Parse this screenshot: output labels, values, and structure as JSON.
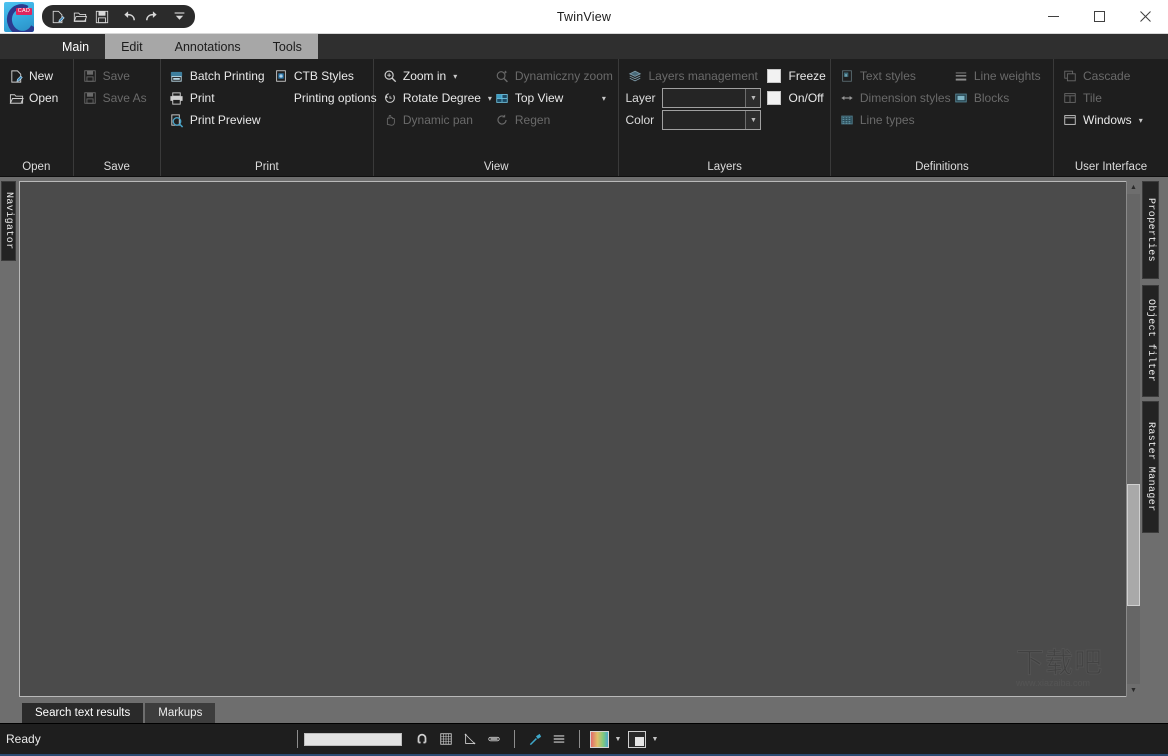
{
  "window": {
    "title": "TwinView",
    "controls": {
      "minimize": "minimize-button",
      "maximize": "maximize-button",
      "close": "close-button"
    }
  },
  "quick_access": {
    "items": [
      {
        "name": "new-document-icon",
        "tooltip": "New"
      },
      {
        "name": "open-folder-icon",
        "tooltip": "Open"
      },
      {
        "name": "save-icon",
        "tooltip": "Save"
      },
      {
        "name": "undo-icon",
        "tooltip": "Undo"
      },
      {
        "name": "redo-icon",
        "tooltip": "Redo"
      },
      {
        "name": "customize-qat-icon",
        "tooltip": "Customize Quick Access Toolbar"
      }
    ]
  },
  "ribbon": {
    "tabs": [
      {
        "label": "Main",
        "active": true
      },
      {
        "label": "Edit",
        "active": false
      },
      {
        "label": "Annotations",
        "active": false
      },
      {
        "label": "Tools",
        "active": false
      }
    ],
    "groups": [
      {
        "title": "Open",
        "items": [
          {
            "label": "New",
            "icon": "new-file-icon",
            "disabled": false
          },
          {
            "label": "Open",
            "icon": "open-folder-icon",
            "disabled": false
          }
        ]
      },
      {
        "title": "Save",
        "items": [
          {
            "label": "Save",
            "icon": "save-icon",
            "disabled": true
          },
          {
            "label": "Save As",
            "icon": "save-as-icon",
            "disabled": true
          }
        ]
      },
      {
        "title": "Print",
        "col1": [
          {
            "label": "Batch Printing",
            "icon": "batch-printing-icon",
            "disabled": false
          },
          {
            "label": "Print",
            "icon": "print-icon",
            "disabled": false
          },
          {
            "label": "Print Preview",
            "icon": "print-preview-icon",
            "disabled": false
          }
        ],
        "col2": [
          {
            "label": "CTB Styles",
            "icon": "ctb-styles-icon",
            "disabled": false
          },
          {
            "label": "Printing options",
            "icon": "",
            "disabled": false
          }
        ]
      },
      {
        "title": "View",
        "col1": [
          {
            "label": "Zoom in",
            "icon": "zoom-in-icon",
            "disabled": false,
            "caret": true
          },
          {
            "label": "Rotate Degree",
            "icon": "rotate-degree-icon",
            "disabled": false,
            "caret": true
          },
          {
            "label": "Dynamic pan",
            "icon": "dynamic-pan-icon",
            "disabled": true,
            "caret": false
          }
        ],
        "col2": [
          {
            "label": "Dynamiczny zoom",
            "icon": "dynamic-zoom-icon",
            "disabled": true,
            "caret": false
          },
          {
            "label": "Top View",
            "icon": "top-view-icon",
            "disabled": false,
            "caret": true
          },
          {
            "label": "Regen",
            "icon": "regen-icon",
            "disabled": true,
            "caret": false
          }
        ]
      },
      {
        "title": "Layers",
        "header": {
          "label": "Layers management",
          "icon": "layers-management-icon",
          "disabled": true
        },
        "layer_label": "Layer",
        "layer_value": "",
        "color_label": "Color",
        "color_value": "",
        "checkboxes": [
          {
            "label": "Freeze",
            "checked": false
          },
          {
            "label": "On/Off",
            "checked": false
          }
        ]
      },
      {
        "title": "Definitions",
        "col1": [
          {
            "label": "Text styles",
            "icon": "text-styles-icon",
            "disabled": true
          },
          {
            "label": "Dimension styles",
            "icon": "dimension-styles-icon",
            "disabled": true
          },
          {
            "label": "Line types",
            "icon": "line-types-icon",
            "disabled": true
          }
        ],
        "col2": [
          {
            "label": "Line weights",
            "icon": "line-weights-icon",
            "disabled": true
          },
          {
            "label": "Blocks",
            "icon": "blocks-icon",
            "disabled": true
          }
        ]
      },
      {
        "title": "User Interface",
        "items": [
          {
            "label": "Cascade",
            "icon": "cascade-icon",
            "disabled": true,
            "caret": false
          },
          {
            "label": "Tile",
            "icon": "tile-icon",
            "disabled": true,
            "caret": false
          },
          {
            "label": "Windows",
            "icon": "windows-icon",
            "disabled": false,
            "caret": true
          }
        ]
      }
    ]
  },
  "docks": {
    "left": [
      {
        "label": "Navigator"
      }
    ],
    "right": [
      {
        "label": "Properties"
      },
      {
        "label": "Object filter"
      },
      {
        "label": "Raster Manager"
      }
    ]
  },
  "canvas": {
    "background_color": "#4b4b4b",
    "watermark_cn": "下载吧",
    "watermark_url": "www.xiazaiba.com"
  },
  "bottom_tabs": [
    {
      "label": "Search text results",
      "active": true
    },
    {
      "label": "Markups",
      "active": false
    }
  ],
  "statusbar": {
    "message": "Ready",
    "command_value": "",
    "tools": [
      {
        "name": "osnap-magnet-icon"
      },
      {
        "name": "grid-icon"
      },
      {
        "name": "ortho-angle-icon"
      },
      {
        "name": "polar-track-icon"
      },
      {
        "name": "measure-tool-icon"
      },
      {
        "name": "line-weight-display-icon"
      },
      {
        "name": "color-palette-swatch"
      },
      {
        "name": "background-swatch"
      }
    ]
  },
  "colors": {
    "ribbon_bg": "#1e1e1e",
    "tabstrip_inactive": "#a7a7a7",
    "tab_active": "#2f2f2f",
    "canvas": "#4b4b4b",
    "dock_bg": "#6e6e6e",
    "accent_blue": "#2b4a72",
    "icon_blue": "#4aa3c7"
  }
}
